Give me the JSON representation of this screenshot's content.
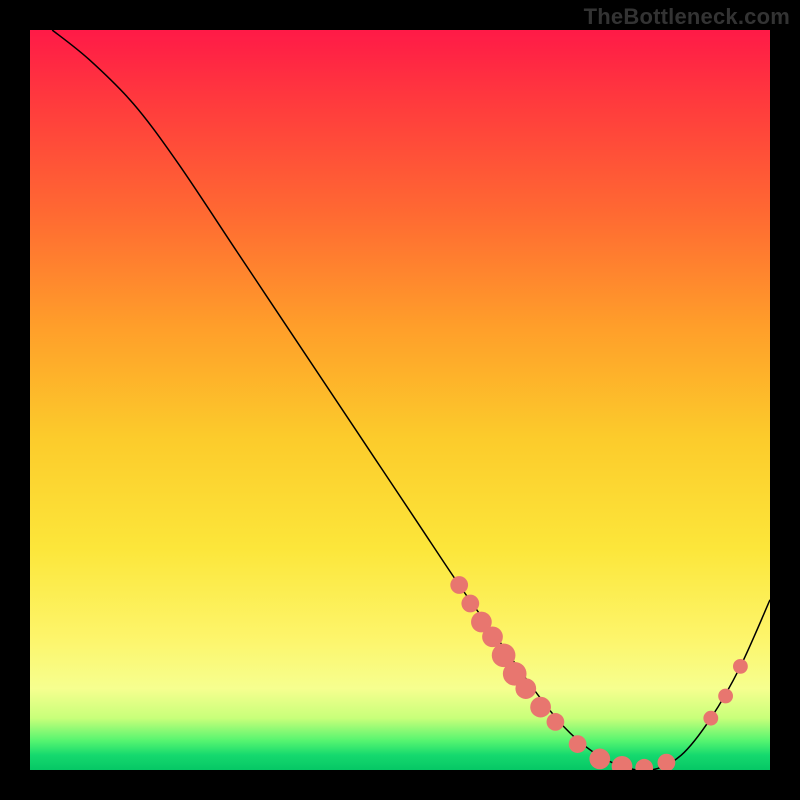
{
  "watermark": "TheBottleneck.com",
  "chart_data": {
    "type": "line",
    "title": "",
    "xlabel": "",
    "ylabel": "",
    "xlim": [
      0,
      100
    ],
    "ylim": [
      0,
      100
    ],
    "grid": false,
    "legend": false,
    "series": [
      {
        "name": "curve",
        "color": "#000000",
        "x": [
          3,
          8,
          14,
          20,
          28,
          36,
          44,
          52,
          58,
          63,
          68,
          72,
          76,
          80,
          84,
          88,
          92,
          96,
          100
        ],
        "y": [
          100,
          96,
          90,
          82,
          70,
          58,
          46,
          34,
          25,
          18,
          11,
          6,
          2.5,
          0.5,
          0,
          2,
          7,
          14,
          23
        ]
      }
    ],
    "markers": [
      {
        "x": 58,
        "y": 25,
        "r": 1.2,
        "color": "#e8766f"
      },
      {
        "x": 59.5,
        "y": 22.5,
        "r": 1.2,
        "color": "#e8766f"
      },
      {
        "x": 61,
        "y": 20,
        "r": 1.4,
        "color": "#e8766f"
      },
      {
        "x": 62.5,
        "y": 18,
        "r": 1.4,
        "color": "#e8766f"
      },
      {
        "x": 64,
        "y": 15.5,
        "r": 1.6,
        "color": "#e8766f"
      },
      {
        "x": 65.5,
        "y": 13,
        "r": 1.6,
        "color": "#e8766f"
      },
      {
        "x": 67,
        "y": 11,
        "r": 1.4,
        "color": "#e8766f"
      },
      {
        "x": 69,
        "y": 8.5,
        "r": 1.4,
        "color": "#e8766f"
      },
      {
        "x": 71,
        "y": 6.5,
        "r": 1.2,
        "color": "#e8766f"
      },
      {
        "x": 74,
        "y": 3.5,
        "r": 1.2,
        "color": "#e8766f"
      },
      {
        "x": 77,
        "y": 1.5,
        "r": 1.4,
        "color": "#e8766f"
      },
      {
        "x": 80,
        "y": 0.5,
        "r": 1.4,
        "color": "#e8766f"
      },
      {
        "x": 83,
        "y": 0.3,
        "r": 1.2,
        "color": "#e8766f"
      },
      {
        "x": 86,
        "y": 1,
        "r": 1.2,
        "color": "#e8766f"
      },
      {
        "x": 92,
        "y": 7,
        "r": 1.0,
        "color": "#e8766f"
      },
      {
        "x": 94,
        "y": 10,
        "r": 1.0,
        "color": "#e8766f"
      },
      {
        "x": 96,
        "y": 14,
        "r": 1.0,
        "color": "#e8766f"
      }
    ],
    "gradient_stops": [
      {
        "pos": 0,
        "color": "#ff1a47"
      },
      {
        "pos": 10,
        "color": "#ff3b3d"
      },
      {
        "pos": 25,
        "color": "#ff6a32"
      },
      {
        "pos": 40,
        "color": "#ff9e2a"
      },
      {
        "pos": 55,
        "color": "#fccb2b"
      },
      {
        "pos": 70,
        "color": "#fce63a"
      },
      {
        "pos": 82,
        "color": "#fdf56a"
      },
      {
        "pos": 89,
        "color": "#f6ff8f"
      },
      {
        "pos": 93,
        "color": "#c8ff7a"
      },
      {
        "pos": 96,
        "color": "#57f570"
      },
      {
        "pos": 98,
        "color": "#15d96e"
      },
      {
        "pos": 100,
        "color": "#06c765"
      }
    ]
  }
}
